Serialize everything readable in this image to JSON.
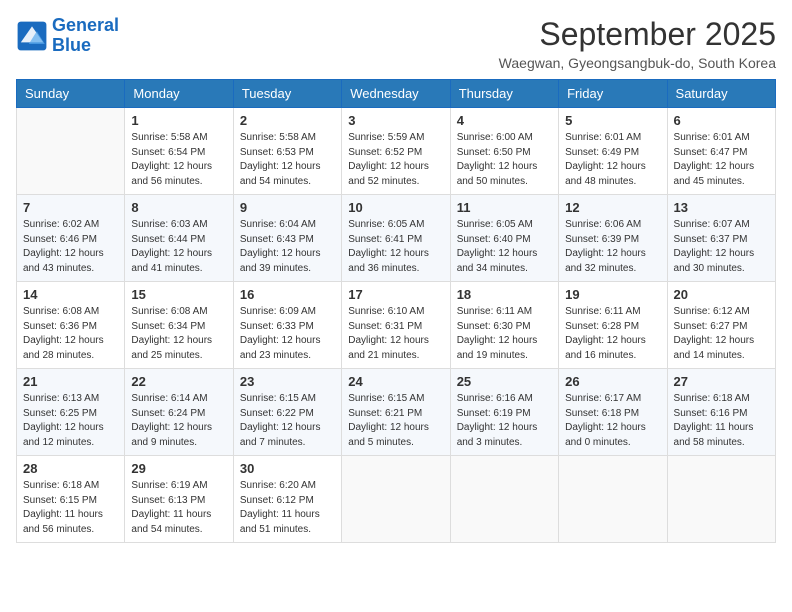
{
  "logo": {
    "line1": "General",
    "line2": "Blue"
  },
  "title": "September 2025",
  "subtitle": "Waegwan, Gyeongsangbuk-do, South Korea",
  "weekdays": [
    "Sunday",
    "Monday",
    "Tuesday",
    "Wednesday",
    "Thursday",
    "Friday",
    "Saturday"
  ],
  "weeks": [
    [
      {
        "day": "",
        "sunrise": "",
        "sunset": "",
        "daylight": ""
      },
      {
        "day": "1",
        "sunrise": "Sunrise: 5:58 AM",
        "sunset": "Sunset: 6:54 PM",
        "daylight": "Daylight: 12 hours and 56 minutes."
      },
      {
        "day": "2",
        "sunrise": "Sunrise: 5:58 AM",
        "sunset": "Sunset: 6:53 PM",
        "daylight": "Daylight: 12 hours and 54 minutes."
      },
      {
        "day": "3",
        "sunrise": "Sunrise: 5:59 AM",
        "sunset": "Sunset: 6:52 PM",
        "daylight": "Daylight: 12 hours and 52 minutes."
      },
      {
        "day": "4",
        "sunrise": "Sunrise: 6:00 AM",
        "sunset": "Sunset: 6:50 PM",
        "daylight": "Daylight: 12 hours and 50 minutes."
      },
      {
        "day": "5",
        "sunrise": "Sunrise: 6:01 AM",
        "sunset": "Sunset: 6:49 PM",
        "daylight": "Daylight: 12 hours and 48 minutes."
      },
      {
        "day": "6",
        "sunrise": "Sunrise: 6:01 AM",
        "sunset": "Sunset: 6:47 PM",
        "daylight": "Daylight: 12 hours and 45 minutes."
      }
    ],
    [
      {
        "day": "7",
        "sunrise": "Sunrise: 6:02 AM",
        "sunset": "Sunset: 6:46 PM",
        "daylight": "Daylight: 12 hours and 43 minutes."
      },
      {
        "day": "8",
        "sunrise": "Sunrise: 6:03 AM",
        "sunset": "Sunset: 6:44 PM",
        "daylight": "Daylight: 12 hours and 41 minutes."
      },
      {
        "day": "9",
        "sunrise": "Sunrise: 6:04 AM",
        "sunset": "Sunset: 6:43 PM",
        "daylight": "Daylight: 12 hours and 39 minutes."
      },
      {
        "day": "10",
        "sunrise": "Sunrise: 6:05 AM",
        "sunset": "Sunset: 6:41 PM",
        "daylight": "Daylight: 12 hours and 36 minutes."
      },
      {
        "day": "11",
        "sunrise": "Sunrise: 6:05 AM",
        "sunset": "Sunset: 6:40 PM",
        "daylight": "Daylight: 12 hours and 34 minutes."
      },
      {
        "day": "12",
        "sunrise": "Sunrise: 6:06 AM",
        "sunset": "Sunset: 6:39 PM",
        "daylight": "Daylight: 12 hours and 32 minutes."
      },
      {
        "day": "13",
        "sunrise": "Sunrise: 6:07 AM",
        "sunset": "Sunset: 6:37 PM",
        "daylight": "Daylight: 12 hours and 30 minutes."
      }
    ],
    [
      {
        "day": "14",
        "sunrise": "Sunrise: 6:08 AM",
        "sunset": "Sunset: 6:36 PM",
        "daylight": "Daylight: 12 hours and 28 minutes."
      },
      {
        "day": "15",
        "sunrise": "Sunrise: 6:08 AM",
        "sunset": "Sunset: 6:34 PM",
        "daylight": "Daylight: 12 hours and 25 minutes."
      },
      {
        "day": "16",
        "sunrise": "Sunrise: 6:09 AM",
        "sunset": "Sunset: 6:33 PM",
        "daylight": "Daylight: 12 hours and 23 minutes."
      },
      {
        "day": "17",
        "sunrise": "Sunrise: 6:10 AM",
        "sunset": "Sunset: 6:31 PM",
        "daylight": "Daylight: 12 hours and 21 minutes."
      },
      {
        "day": "18",
        "sunrise": "Sunrise: 6:11 AM",
        "sunset": "Sunset: 6:30 PM",
        "daylight": "Daylight: 12 hours and 19 minutes."
      },
      {
        "day": "19",
        "sunrise": "Sunrise: 6:11 AM",
        "sunset": "Sunset: 6:28 PM",
        "daylight": "Daylight: 12 hours and 16 minutes."
      },
      {
        "day": "20",
        "sunrise": "Sunrise: 6:12 AM",
        "sunset": "Sunset: 6:27 PM",
        "daylight": "Daylight: 12 hours and 14 minutes."
      }
    ],
    [
      {
        "day": "21",
        "sunrise": "Sunrise: 6:13 AM",
        "sunset": "Sunset: 6:25 PM",
        "daylight": "Daylight: 12 hours and 12 minutes."
      },
      {
        "day": "22",
        "sunrise": "Sunrise: 6:14 AM",
        "sunset": "Sunset: 6:24 PM",
        "daylight": "Daylight: 12 hours and 9 minutes."
      },
      {
        "day": "23",
        "sunrise": "Sunrise: 6:15 AM",
        "sunset": "Sunset: 6:22 PM",
        "daylight": "Daylight: 12 hours and 7 minutes."
      },
      {
        "day": "24",
        "sunrise": "Sunrise: 6:15 AM",
        "sunset": "Sunset: 6:21 PM",
        "daylight": "Daylight: 12 hours and 5 minutes."
      },
      {
        "day": "25",
        "sunrise": "Sunrise: 6:16 AM",
        "sunset": "Sunset: 6:19 PM",
        "daylight": "Daylight: 12 hours and 3 minutes."
      },
      {
        "day": "26",
        "sunrise": "Sunrise: 6:17 AM",
        "sunset": "Sunset: 6:18 PM",
        "daylight": "Daylight: 12 hours and 0 minutes."
      },
      {
        "day": "27",
        "sunrise": "Sunrise: 6:18 AM",
        "sunset": "Sunset: 6:16 PM",
        "daylight": "Daylight: 11 hours and 58 minutes."
      }
    ],
    [
      {
        "day": "28",
        "sunrise": "Sunrise: 6:18 AM",
        "sunset": "Sunset: 6:15 PM",
        "daylight": "Daylight: 11 hours and 56 minutes."
      },
      {
        "day": "29",
        "sunrise": "Sunrise: 6:19 AM",
        "sunset": "Sunset: 6:13 PM",
        "daylight": "Daylight: 11 hours and 54 minutes."
      },
      {
        "day": "30",
        "sunrise": "Sunrise: 6:20 AM",
        "sunset": "Sunset: 6:12 PM",
        "daylight": "Daylight: 11 hours and 51 minutes."
      },
      {
        "day": "",
        "sunrise": "",
        "sunset": "",
        "daylight": ""
      },
      {
        "day": "",
        "sunrise": "",
        "sunset": "",
        "daylight": ""
      },
      {
        "day": "",
        "sunrise": "",
        "sunset": "",
        "daylight": ""
      },
      {
        "day": "",
        "sunrise": "",
        "sunset": "",
        "daylight": ""
      }
    ]
  ]
}
